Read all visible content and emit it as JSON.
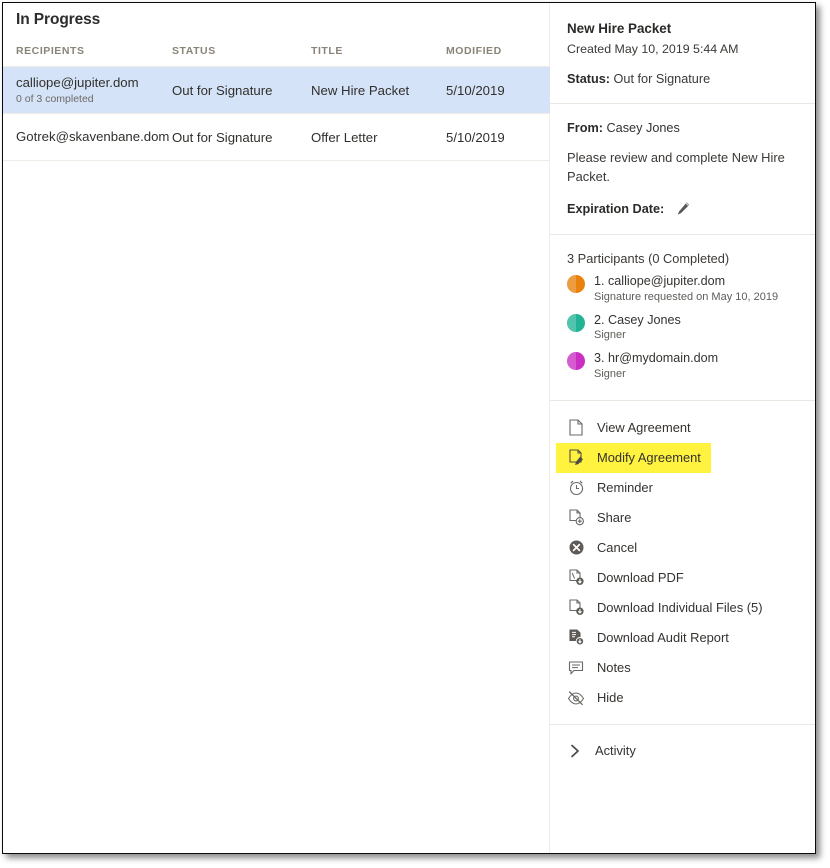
{
  "left_panel": {
    "title": "In Progress",
    "columns": [
      "RECIPIENTS",
      "STATUS",
      "TITLE",
      "MODIFIED"
    ],
    "rows": [
      {
        "recipient": "calliope@jupiter.dom",
        "recipient_sub": "0 of 3 completed",
        "status": "Out for Signature",
        "title": "New Hire Packet",
        "modified": "5/10/2019",
        "selected": true
      },
      {
        "recipient": "Gotrek@skavenbane.dom",
        "recipient_sub": "",
        "status": "Out for Signature",
        "title": "Offer Letter",
        "modified": "5/10/2019",
        "selected": false
      }
    ]
  },
  "right_panel": {
    "agreement_name": "New Hire Packet",
    "created": "Created May 10, 2019 5:44 AM",
    "status_label": "Status:",
    "status_value": "Out for Signature",
    "from_label": "From:",
    "from_value": "Casey Jones",
    "message": "Please review and complete New Hire Packet.",
    "expiration_label": "Expiration Date:",
    "expiration_edit_icon": "pencil-icon",
    "participants_heading": "3 Participants (0 Completed)",
    "participants": [
      {
        "name": "1. calliope@jupiter.dom",
        "sub": "Signature requested on May 10, 2019",
        "color": "#E8820C"
      },
      {
        "name": "2. Casey Jones",
        "sub": "Signer",
        "color": "#22B396"
      },
      {
        "name": "3. hr@mydomain.dom",
        "sub": "Signer",
        "color": "#CB2EC3"
      }
    ],
    "actions": [
      {
        "label": "View Agreement",
        "icon": "document-icon",
        "highlighted": false
      },
      {
        "label": "Modify Agreement",
        "icon": "document-edit-icon",
        "highlighted": true
      },
      {
        "label": "Reminder",
        "icon": "alarm-clock-icon",
        "highlighted": false
      },
      {
        "label": "Share",
        "icon": "document-share-icon",
        "highlighted": false
      },
      {
        "label": "Cancel",
        "icon": "cancel-circle-icon",
        "highlighted": false
      },
      {
        "label": "Download PDF",
        "icon": "download-pdf-icon",
        "highlighted": false
      },
      {
        "label": "Download Individual Files (5)",
        "icon": "download-file-icon",
        "highlighted": false
      },
      {
        "label": "Download Audit Report",
        "icon": "download-report-icon",
        "highlighted": false
      },
      {
        "label": "Notes",
        "icon": "note-bubble-icon",
        "highlighted": false
      },
      {
        "label": "Hide",
        "icon": "eye-hidden-icon",
        "highlighted": false
      }
    ],
    "activity_label": "Activity",
    "activity_icon": "chevron-right-icon"
  },
  "colors": {
    "selected_row": "#d4e3f7",
    "highlight": "#FFF33F",
    "divider": "#ebe8e3",
    "header_text": "#8a8378"
  }
}
